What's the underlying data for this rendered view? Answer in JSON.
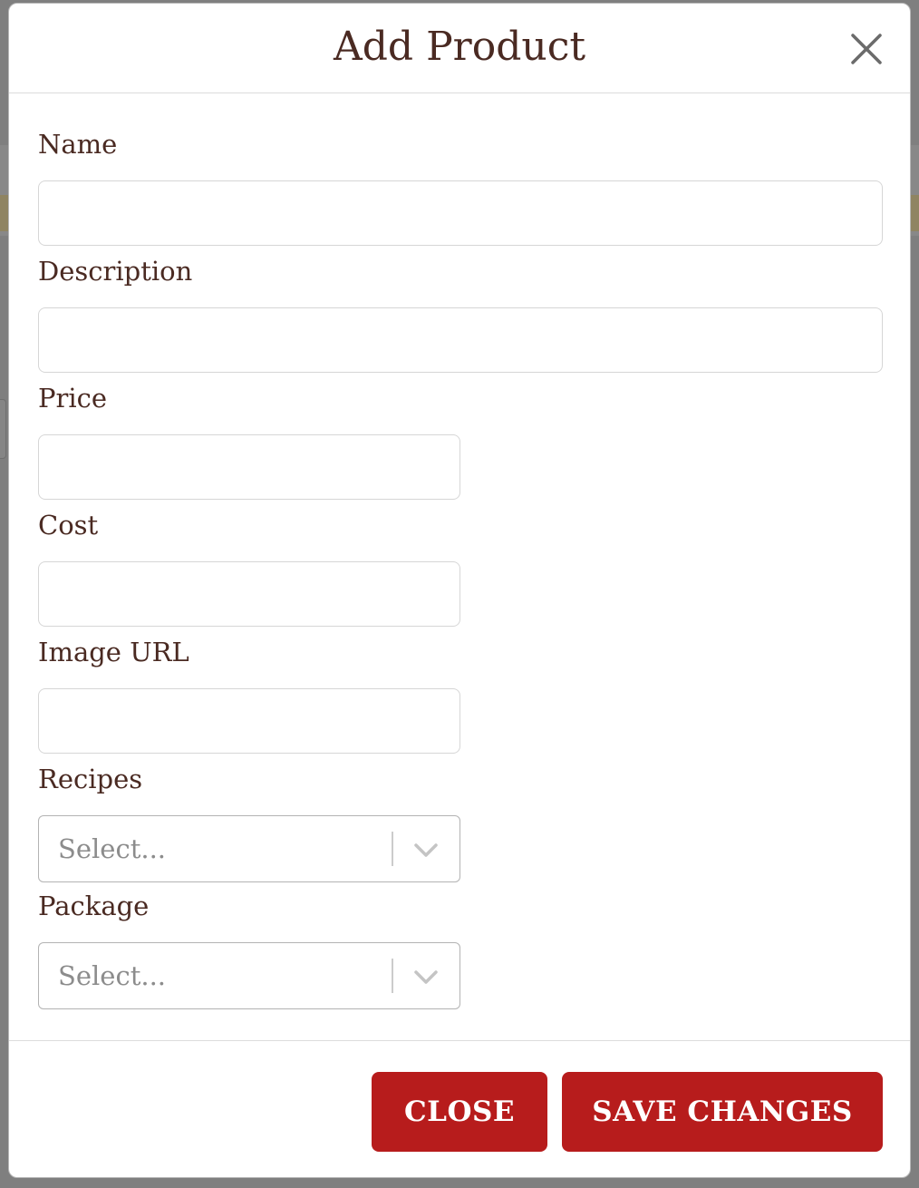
{
  "modal": {
    "title": "Add Product",
    "close_icon": "close-icon"
  },
  "form": {
    "name": {
      "label": "Name",
      "value": "",
      "placeholder": ""
    },
    "description": {
      "label": "Description",
      "value": "",
      "placeholder": ""
    },
    "price": {
      "label": "Price",
      "value": "",
      "placeholder": ""
    },
    "cost": {
      "label": "Cost",
      "value": "",
      "placeholder": ""
    },
    "image_url": {
      "label": "Image URL",
      "value": "",
      "placeholder": ""
    },
    "recipes": {
      "label": "Recipes",
      "placeholder": "Select...",
      "icon": "chevron-down-icon"
    },
    "package": {
      "label": "Package",
      "placeholder": "Select...",
      "icon": "chevron-down-icon"
    }
  },
  "footer": {
    "close_label": "CLOSE",
    "save_label": "SAVE CHANGES"
  },
  "colors": {
    "primary_button": "#b71c1c",
    "text": "#4a2a22",
    "placeholder": "#8c8c8c",
    "overlay": "#808080"
  }
}
